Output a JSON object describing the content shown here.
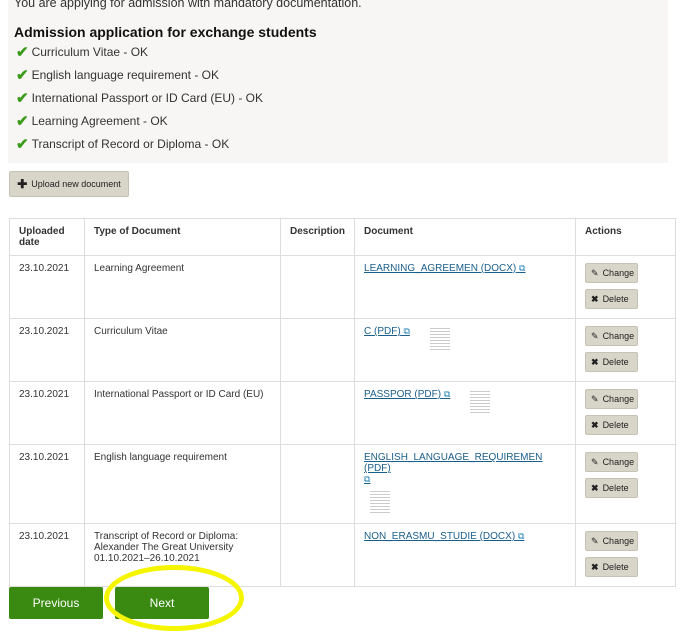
{
  "intro": "You are applying for admission with mandatory documentation.",
  "heading": "Admission application for exchange students",
  "checklist": [
    "Curriculum Vitae - OK",
    "English language requirement - OK",
    "International Passport or ID Card (EU) - OK",
    "Learning Agreement - OK",
    "Transcript of Record or Diploma - OK"
  ],
  "upload_label": "Upload new document",
  "columns": [
    "Uploaded date",
    "Type of Document",
    "Description",
    "Document",
    "Actions"
  ],
  "rows": [
    {
      "date": "23.10.2021",
      "type": "Learning Agreement",
      "doc": "LEARNING_AGREEMEN (DOCX)"
    },
    {
      "date": "23.10.2021",
      "type": "Curriculum Vitae",
      "doc": "C (PDF)"
    },
    {
      "date": "23.10.2021",
      "type": "International Passport or ID Card (EU)",
      "doc": "PASSPOR (PDF)"
    },
    {
      "date": "23.10.2021",
      "type": "English language requirement",
      "doc": "ENGLISH_LANGUAGE_REQUIREMEN (PDF)"
    },
    {
      "date": "23.10.2021",
      "type": "Transcript of Record or Diploma: Alexander The Great University 01.10.2021–26.10.2021",
      "doc": "NON_ERASMU_STUDIE (DOCX)"
    }
  ],
  "change_label": "Change",
  "delete_label": "Delete",
  "previous_label": "Previous",
  "next_label": "Next",
  "colors": {
    "accent": "#3a8a12",
    "check": "#3a9b1a",
    "highlight": "#f5f500"
  }
}
